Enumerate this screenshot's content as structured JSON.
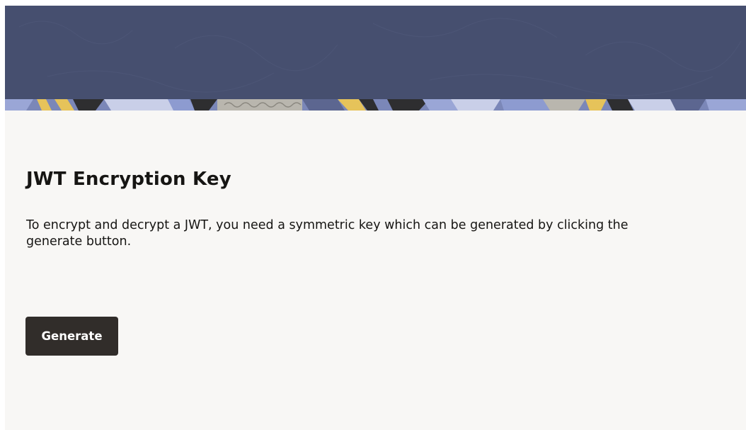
{
  "banner": {
    "colors": {
      "navy": "#464f6f",
      "periwinkle": "#8d9bd0",
      "gold": "#e6c35a",
      "charcoal": "#2e2e30",
      "stone": "#b9b6ae"
    }
  },
  "content": {
    "title": "JWT Encryption Key",
    "description": "To encrypt and decrypt a JWT, you need a symmetric key which can be generated by clicking the generate button."
  },
  "actions": {
    "generate_label": "Generate"
  },
  "colors": {
    "page_background": "#f8f7f5",
    "button_background": "#312d2a",
    "text": "#161513"
  }
}
